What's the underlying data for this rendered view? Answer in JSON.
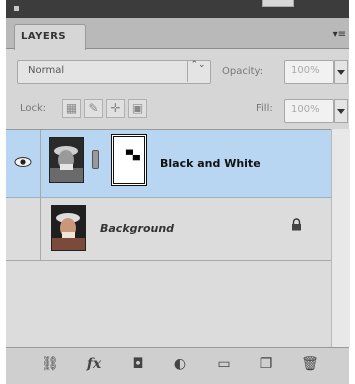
{
  "panel": {
    "tab_label": "LAYERS",
    "menu_glyph": "▾≡"
  },
  "blend": {
    "mode": "Normal",
    "arrow_glyph": "⌃⌄",
    "opacity_label": "Opacity:",
    "opacity_value": "100%"
  },
  "lock": {
    "label": "Lock:",
    "fill_label": "Fill:",
    "fill_value": "100%",
    "icons": [
      "lock-transparent-pixels-icon",
      "lock-image-pixels-icon",
      "lock-position-icon",
      "lock-all-icon"
    ]
  },
  "layers": [
    {
      "name": "Black and White",
      "selected": true,
      "visible": true,
      "has_mask": true,
      "locked": false
    },
    {
      "name": "Background",
      "selected": false,
      "visible": false,
      "has_mask": false,
      "locked": true
    }
  ],
  "bottom_icons": [
    "link-layers-icon",
    "layer-style-fx-icon",
    "add-mask-icon",
    "adjustment-layer-icon",
    "new-group-icon",
    "new-layer-icon",
    "delete-layer-icon"
  ],
  "colors": {
    "selected_row": "#b8d6f2",
    "panel_bg": "#d6d6d6",
    "header_bg": "#3c3c3c"
  }
}
